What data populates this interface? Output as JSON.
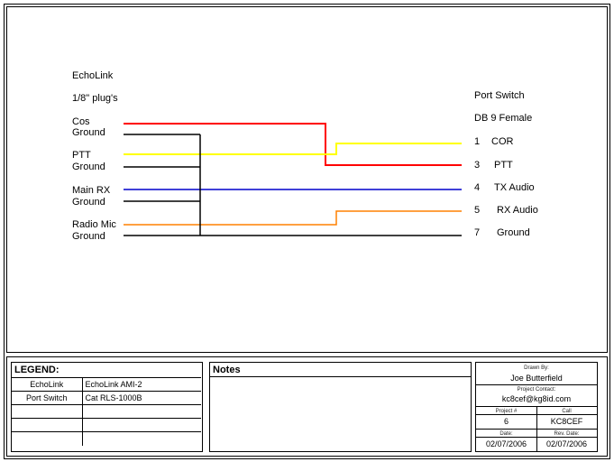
{
  "left_header": {
    "title": "EchoLink",
    "subtitle": "1/8\" plug's"
  },
  "left_pins": [
    {
      "label": "Cos"
    },
    {
      "label": "Ground"
    },
    {
      "label": "PTT"
    },
    {
      "label": "Ground"
    },
    {
      "label": "Main RX"
    },
    {
      "label": "Ground"
    },
    {
      "label": "Radio Mic"
    },
    {
      "label": "Ground"
    }
  ],
  "right_header": {
    "title": "Port Switch",
    "subtitle": "DB 9 Female"
  },
  "right_pins": [
    {
      "number": "1",
      "label": "COR"
    },
    {
      "number": "3",
      "label": "PTT"
    },
    {
      "number": "4",
      "label": "TX Audio"
    },
    {
      "number": "5",
      "label": "RX Audio"
    },
    {
      "number": "7",
      "label": "Ground"
    }
  ],
  "wire_colors": {
    "cos": "#ff0000",
    "ptt": "#ffff00",
    "main_rx": "#0000cc",
    "radio_mic": "#ff8000",
    "ground": "#000000"
  },
  "legend": {
    "title": "LEGEND:",
    "rows": [
      [
        "EchoLink",
        "EchoLink AMI-2"
      ],
      [
        "Port Switch",
        "Cat RLS-1000B"
      ],
      [
        "",
        ""
      ],
      [
        "",
        ""
      ],
      [
        "",
        ""
      ]
    ]
  },
  "notes": {
    "title": "Notes"
  },
  "title_block": {
    "drawn_by_label": "Drawn By:",
    "drawn_by": "Joe Butterfield",
    "contact_label": "Project Contact:",
    "contact": "kc8cef@kg8id.com",
    "project_label": "Project #",
    "project": "6",
    "call_label": "Call",
    "call": "KC8CEF",
    "date_label": "Date:",
    "date": "02/07/2006",
    "rev_label": "Rev. Date:",
    "rev_date": "02/07/2006"
  }
}
